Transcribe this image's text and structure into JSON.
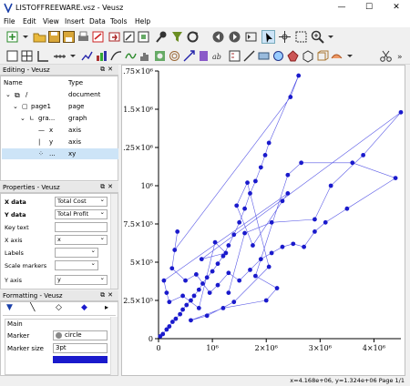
{
  "window": {
    "title": "LISTOFFREEWARE.vsz - Veusz",
    "minimize": "—",
    "maximize": "☐",
    "close": "✕"
  },
  "menu": [
    "File",
    "Edit",
    "View",
    "Insert",
    "Data",
    "Tools",
    "Help"
  ],
  "editing_panel": {
    "title": "Editing - Veusz",
    "columns": [
      "Name",
      "Type"
    ],
    "rows": [
      {
        "name": "/",
        "type": "document"
      },
      {
        "name": "page1",
        "type": "page"
      },
      {
        "name": "gra...",
        "type": "graph"
      },
      {
        "name": "x",
        "type": "axis"
      },
      {
        "name": "y",
        "type": "axis"
      },
      {
        "name": "...",
        "type": "xy"
      }
    ]
  },
  "properties_panel": {
    "title": "Properties - Veusz",
    "rows": [
      {
        "label": "X data",
        "value": "Total Cost"
      },
      {
        "label": "Y data",
        "value": "Total Profit"
      },
      {
        "label": "Key text",
        "value": ""
      },
      {
        "label": "X axis",
        "value": "x"
      },
      {
        "label": "Labels",
        "value": ""
      },
      {
        "label": "Scale markers",
        "value": ""
      },
      {
        "label": "Y axis",
        "value": "y"
      }
    ]
  },
  "formatting_panel": {
    "title": "Formatting - Veusz",
    "section": "Main",
    "rows": [
      {
        "label": "Marker",
        "value": "circle"
      },
      {
        "label": "Marker size",
        "value": "3pt"
      }
    ]
  },
  "status": "x=4.168e+06, y=1.324e+06  Page 1/1",
  "colors": {
    "series": "#1a1acc",
    "accent": "#2222dd"
  },
  "chart_data": {
    "type": "scatter",
    "connected": true,
    "x_ticks": [
      "0",
      "10⁶",
      "2×10⁶",
      "3×10⁶",
      "4×10⁶"
    ],
    "y_ticks": [
      "0",
      "2.5×10⁵",
      "5×10⁵",
      "7.5×10⁵",
      "10⁶",
      "1.25×10⁶",
      "1.5×10⁶",
      "1.75×10⁶"
    ],
    "xlim": [
      0,
      4500000
    ],
    "ylim": [
      0,
      1750000
    ],
    "points": [
      [
        30000,
        15000
      ],
      [
        80000,
        30000
      ],
      [
        150000,
        60000
      ],
      [
        200000,
        80000
      ],
      [
        260000,
        110000
      ],
      [
        320000,
        130000
      ],
      [
        400000,
        160000
      ],
      [
        450000,
        190000
      ],
      [
        520000,
        220000
      ],
      [
        600000,
        250000
      ],
      [
        660000,
        280000
      ],
      [
        750000,
        320000
      ],
      [
        820000,
        360000
      ],
      [
        900000,
        400000
      ],
      [
        1000000,
        440000
      ],
      [
        1100000,
        490000
      ],
      [
        1200000,
        540000
      ],
      [
        1300000,
        610000
      ],
      [
        1400000,
        680000
      ],
      [
        1500000,
        760000
      ],
      [
        1600000,
        850000
      ],
      [
        1700000,
        950000
      ],
      [
        1800000,
        1030000
      ],
      [
        1900000,
        1120000
      ],
      [
        1980000,
        1200000
      ],
      [
        2050000,
        1280000
      ],
      [
        2600000,
        1720000
      ],
      [
        2450000,
        1580000
      ],
      [
        300000,
        580000
      ],
      [
        350000,
        700000
      ],
      [
        250000,
        460000
      ],
      [
        500000,
        380000
      ],
      [
        700000,
        420000
      ],
      [
        950000,
        300000
      ],
      [
        1100000,
        350000
      ],
      [
        1300000,
        430000
      ],
      [
        1500000,
        380000
      ],
      [
        1700000,
        450000
      ],
      [
        1900000,
        520000
      ],
      [
        2100000,
        560000
      ],
      [
        2300000,
        600000
      ],
      [
        2500000,
        620000
      ],
      [
        2700000,
        600000
      ],
      [
        2900000,
        700000
      ],
      [
        3100000,
        760000
      ],
      [
        3500000,
        850000
      ],
      [
        4400000,
        1050000
      ],
      [
        3600000,
        1150000
      ],
      [
        2650000,
        1150000
      ],
      [
        2400000,
        1070000
      ],
      [
        1800000,
        410000
      ],
      [
        2200000,
        330000
      ],
      [
        2000000,
        250000
      ],
      [
        1200000,
        200000
      ],
      [
        600000,
        120000
      ],
      [
        900000,
        150000
      ],
      [
        1400000,
        240000
      ],
      [
        2050000,
        470000
      ],
      [
        1650000,
        1020000
      ],
      [
        1450000,
        870000
      ],
      [
        1750000,
        610000
      ],
      [
        2300000,
        900000
      ],
      [
        2400000,
        950000
      ],
      [
        100000,
        380000
      ],
      [
        150000,
        300000
      ],
      [
        200000,
        240000
      ],
      [
        450000,
        280000
      ],
      [
        750000,
        200000
      ],
      [
        1050000,
        630000
      ],
      [
        1250000,
        560000
      ],
      [
        800000,
        520000
      ],
      [
        4500000,
        1480000
      ],
      [
        3800000,
        1200000
      ],
      [
        3200000,
        1000000
      ],
      [
        2900000,
        780000
      ],
      [
        2100000,
        760000
      ],
      [
        1600000,
        690000
      ],
      [
        1300000,
        300000
      ]
    ]
  }
}
